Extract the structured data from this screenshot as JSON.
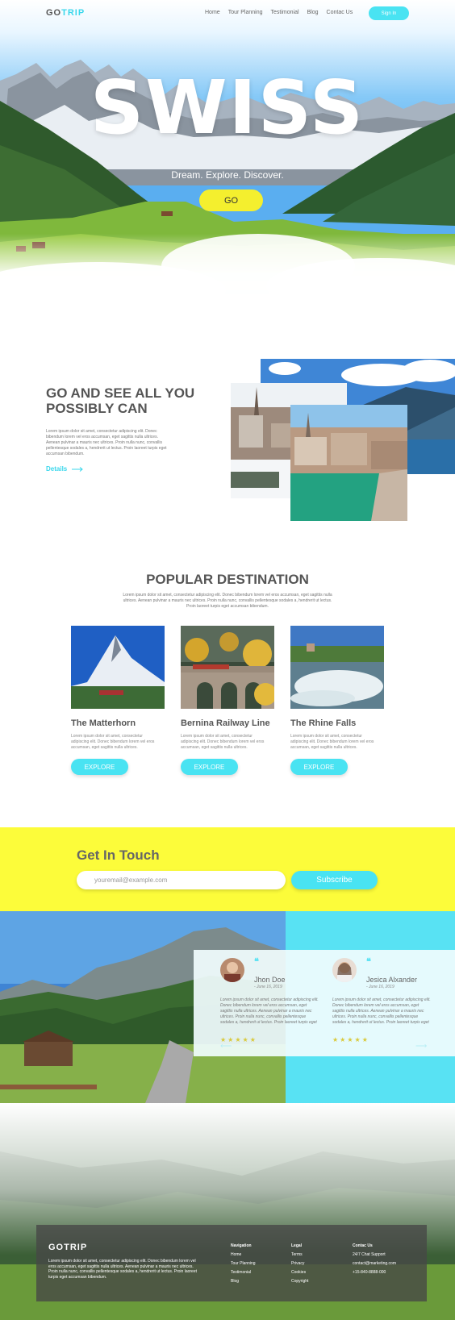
{
  "header": {
    "logo_go": "GO",
    "logo_trip": "TRIP",
    "nav": [
      "Home",
      "Tour Planning",
      "Testimonial",
      "Blog",
      "Contac Us"
    ],
    "signin": "Sign In"
  },
  "hero": {
    "title": "SWISS",
    "subtitle": "Dream. Explore. Discover.",
    "button": "GO"
  },
  "about": {
    "title": "GO AND SEE ALL YOU POSSIBLY CAN",
    "text": "Lorem ipsum dolor sit amet, consectetur adipiscing elit. Donec bibendum lorem vel eros accumsan, eget sagittis nulla ultrices. Aenean pulvinar a mauris nec ultrices. Proin nulla nunc, convallis pellentesque sodales a, hendrerit ut lectus. Proin laoreet turpis eget accumsan bibendum.",
    "link": "Details"
  },
  "popular": {
    "title": "POPULAR DESTINATION",
    "subtitle": "Lorem ipsum dolor sit amet, consectetur adipiscing elit. Donec bibendum lorem vel eros accumsan, eget sagittis nulla ultrices. Aenean pulvinar a mauris nec ultrices. Proin nulla nunc, convallis pellentesque sodales a, hendrerit ut lectus. Proin laoreet turpis eget accumsan bibendum.",
    "cards": [
      {
        "name": "The Matterhorn",
        "desc": "Lorem ipsum dolor sit amet, consectetur adipiscing elit. Donec bibendum lorem vel eros accumsan, eget sagittis nulla ultrices.",
        "button": "EXPLORE"
      },
      {
        "name": "Bernina Railway Line",
        "desc": "Lorem ipsum dolor sit amet, consectetur adipiscing elit. Donec bibendum lorem vel eros accumsan, eget sagittis nulla ultrices.",
        "button": "EXPLORE"
      },
      {
        "name": "The Rhine Falls",
        "desc": "Lorem ipsum dolor sit amet, consectetur adipiscing elit. Donec bibendum lorem vel eros accumsan, eget sagittis nulla ultrices.",
        "button": "EXPLORE"
      }
    ]
  },
  "touch": {
    "title": "Get In Touch",
    "placeholder": "youremail@example.com",
    "button": "Subscribe"
  },
  "testimonials": [
    {
      "name": "Jhon Doe",
      "date": "- June 16, 2019",
      "text": "Lorem ipsum dolor sit amet, consectetur adipiscing elit. Donec bibendum lorem vel eros accumsan, eget sagittis nulla ultrices. Aenean pulvinar a mauris nec ultrices. Proin nulla nunc, convallis pellentesque sodales a, hendrerit ut lectus. Proin laoreet turpis eget",
      "stars": "★★★★★",
      "rating": 5
    },
    {
      "name": "Jesica Alxander",
      "date": "- June 16, 2019",
      "text": "Lorem ipsum dolor sit amet, consectetur adipiscing elit. Donec bibendum lorem vel eros accumsan, eget sagittis nulla ultrices. Aenean pulvinar a mauris nec ultrices. Proin nulla nunc, convallis pellentesque sodales a, hendrerit ut lectus. Proin laoreet turpis eget",
      "stars": "★★★★★",
      "rating": 5
    }
  ],
  "footer": {
    "logo": "GOTRIP",
    "text": "Lorem ipsum dolor sit amet, consectetur adipiscing elit. Donec bibendum lorem vel eros accumsan, eget sagittis nulla ultrices. Aenean pulvinar a mauris nec ultrices. Proin nulla nunc, convallis pellentesque sodales a, hendrerit ut lectus. Proin laoreet turpis eget accumsan bibendum.",
    "navigation": {
      "title": "Navigation",
      "items": [
        "Home",
        "Tour Planning",
        "Testimonial",
        "Blog"
      ]
    },
    "legal": {
      "title": "Legal",
      "items": [
        "Terms",
        "Privacy",
        "Cookies",
        "Copyright"
      ]
    },
    "contact": {
      "title": "Contac Us",
      "items": [
        "24/7 Chat Support",
        "contact@marketing.com",
        "+15-840-8888-000"
      ]
    }
  },
  "colors": {
    "accent": "#49e3f2",
    "yellow": "#fcfc3a",
    "text": "#555555"
  }
}
